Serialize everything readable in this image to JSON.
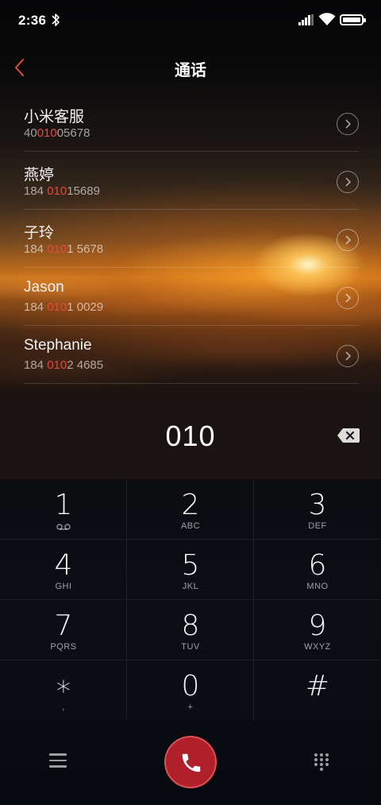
{
  "status_bar": {
    "time": "2:36",
    "icons": [
      "bluetooth-icon",
      "signal-icon",
      "wifi-icon",
      "battery-icon"
    ]
  },
  "header": {
    "title": "通话",
    "back_icon": "chevron-left-icon"
  },
  "colors": {
    "accent_red": "#e8483d",
    "call_button": "#b0202a"
  },
  "contacts": [
    {
      "name": "小米客服",
      "number_pre": "40",
      "number_match": "010",
      "number_post": "05678"
    },
    {
      "name": "燕婷",
      "number_pre": "184 ",
      "number_match": "010",
      "number_post": "15689"
    },
    {
      "name": "子玲",
      "number_pre": "184 ",
      "number_match": "010",
      "number_post": "1 5678"
    },
    {
      "name": "Jason",
      "number_pre": "184 ",
      "number_match": "010",
      "number_post": "1 0029"
    },
    {
      "name": "Stephanie",
      "number_pre": "184 ",
      "number_match": "010",
      "number_post": "2 4685"
    }
  ],
  "input": {
    "number": "010",
    "backspace_icon": "backspace-icon"
  },
  "keypad": [
    {
      "digit": "1",
      "letters": "",
      "sub_icon": "voicemail-icon"
    },
    {
      "digit": "2",
      "letters": "ABC"
    },
    {
      "digit": "3",
      "letters": "DEF"
    },
    {
      "digit": "4",
      "letters": "GHI"
    },
    {
      "digit": "5",
      "letters": "JKL"
    },
    {
      "digit": "6",
      "letters": "MNO"
    },
    {
      "digit": "7",
      "letters": "PQRS"
    },
    {
      "digit": "8",
      "letters": "TUV"
    },
    {
      "digit": "9",
      "letters": "WXYZ"
    },
    {
      "digit": "∗",
      "letters": ","
    },
    {
      "digit": "0",
      "letters": "+"
    },
    {
      "digit": "#",
      "letters": ""
    }
  ],
  "bottom_bar": {
    "left_icon": "menu-icon",
    "center_icon": "phone-icon",
    "right_icon": "dialpad-icon"
  }
}
